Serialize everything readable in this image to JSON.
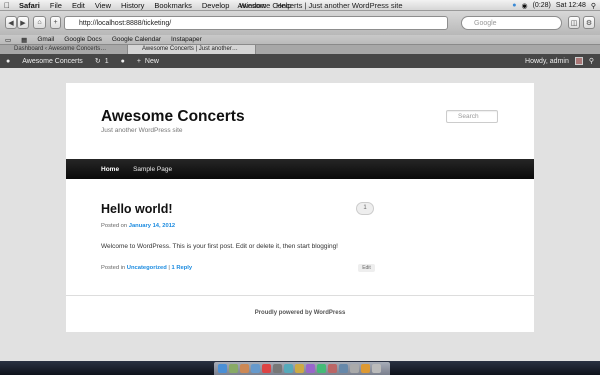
{
  "menubar": {
    "app": "Safari",
    "items": [
      "File",
      "Edit",
      "View",
      "History",
      "Bookmarks",
      "Develop",
      "Window",
      "Help"
    ],
    "window_title": "Awesome Concerts | Just another WordPress site",
    "battery": "(0:28)",
    "clock": "Sat 12:48"
  },
  "toolbar": {
    "url": "http://localhost:8888/ticketing/",
    "search_placeholder": "Google"
  },
  "bookmarks": [
    "Gmail",
    "Google Docs",
    "Google Calendar",
    "Instapaper"
  ],
  "tabs": [
    {
      "label": "Dashboard ‹ Awesome Concerts…"
    },
    {
      "label": "Awesome Concerts | Just another…"
    }
  ],
  "adminbar": {
    "site_name": "Awesome Concerts",
    "updates_count": "1",
    "new_label": "New",
    "howdy": "Howdy, admin"
  },
  "site": {
    "title": "Awesome Concerts",
    "description": "Just another WordPress site",
    "search_placeholder": "Search",
    "nav": [
      "Home",
      "Sample Page"
    ]
  },
  "post": {
    "title": "Hello world!",
    "comment_count": "1",
    "posted_on_prefix": "Posted on",
    "date": "January 14, 2012",
    "content": "Welcome to WordPress. This is your first post. Edit or delete it, then start blogging!",
    "posted_in_prefix": "Posted in",
    "category": "Uncategorized",
    "separator": "|",
    "reply_link": "1 Reply",
    "edit_label": "Edit"
  },
  "footer": {
    "text": "Proudly powered by WordPress"
  },
  "colors": {
    "link": "#1b8be0",
    "nav_bg": "#111111",
    "admin_bar": "#464646"
  }
}
